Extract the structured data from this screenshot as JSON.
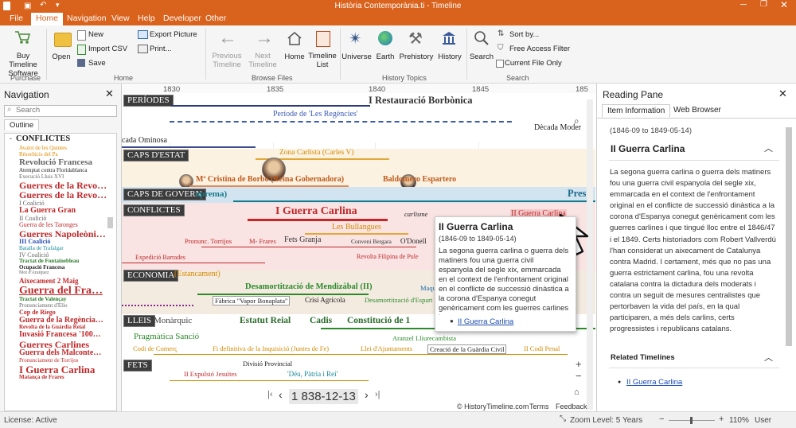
{
  "window": {
    "title": "Història Contemporània.ti - Timeline"
  },
  "menu": {
    "file": "File",
    "home": "Home",
    "navigation": "Navigation",
    "view": "View",
    "help": "Help",
    "developer": "Developer",
    "other": "Other"
  },
  "ribbon": {
    "buy": "Buy Timeline Software",
    "purchase_group": "Purchase",
    "open": "Open",
    "new": "New",
    "import_csv": "Import CSV",
    "save": "Save",
    "export_picture": "Export Picture",
    "print": "Print...",
    "home_group": "Home",
    "prev_timeline": "Previous Timeline",
    "next_timeline": "Next Timeline",
    "home_btn": "Home",
    "timeline_list": "Timeline List",
    "browse_group": "Browse Files",
    "universe": "Universe",
    "earth": "Earth",
    "prehistory": "Prehistory",
    "history": "History",
    "history_group": "History Topics",
    "search": "Search",
    "sort_by": "Sort by...",
    "free_access_filter": "Free Access Filter",
    "current_file_only": "Current File Only",
    "search_group": "Search"
  },
  "navigation": {
    "title": "Navigation",
    "search_placeholder": "Search",
    "outline_tab": "Outline",
    "root": "CONFLICTES",
    "items": [
      {
        "label": "Avalot de les Quintes",
        "color": "#e08a00",
        "size": 7
      },
      {
        "label": "Rèsorbicis del Pa",
        "color": "#e08a00",
        "size": 7
      },
      {
        "label": "Revolució Francesa",
        "color": "#666666",
        "size": 11,
        "bold": true
      },
      {
        "label": "Atemptat contra Floridablanca",
        "color": "#222222",
        "size": 7
      },
      {
        "label": "Execució Lluis XVI",
        "color": "#666666",
        "size": 7
      },
      {
        "label": "Guerres de la Revo…",
        "color": "#c0282a",
        "size": 12,
        "bold": true
      },
      {
        "label": "Guerres de la Revo…",
        "color": "#c0282a",
        "size": 12,
        "bold": true
      },
      {
        "label": "I Coalició",
        "color": "#666666",
        "size": 8
      },
      {
        "label": "La Guerra Gran",
        "color": "#c0282a",
        "size": 10,
        "bold": true
      },
      {
        "label": "II Coalició",
        "color": "#666666",
        "size": 8
      },
      {
        "label": "Guerra de les Taronges",
        "color": "#c0282a",
        "size": 8
      },
      {
        "label": "Guerres Napoleòni…",
        "color": "#c0282a",
        "size": 12,
        "bold": true
      },
      {
        "label": "III Coalició",
        "color": "#2a4cb0",
        "size": 8,
        "bold": true
      },
      {
        "label": "Batalla de Trafalgar",
        "color": "#1a8a9a",
        "size": 7
      },
      {
        "label": "IV Coalició",
        "color": "#666666",
        "size": 8
      },
      {
        "label": "Tractat de Fontainebleau",
        "color": "#2a7a2a",
        "size": 7,
        "bold": true
      },
      {
        "label": "Ocupació Francesa",
        "color": "#222222",
        "size": 7,
        "bold": true
      },
      {
        "label": "Mot d'Aranjuez",
        "color": "#666666",
        "size": 6
      },
      {
        "label": "Aixecament 2 Maig",
        "color": "#c0282a",
        "size": 9,
        "bold": true
      },
      {
        "label": "Guerra del Fra…",
        "color": "#c0282a",
        "size": 14,
        "bold": true,
        "underline": true
      },
      {
        "label": "Tractat de Valençay",
        "color": "#2a7a2a",
        "size": 7,
        "bold": true
      },
      {
        "label": "Pronunciament d'Elio",
        "color": "#666666",
        "size": 7
      },
      {
        "label": "Cop de Riego",
        "color": "#c0282a",
        "size": 8,
        "bold": true
      },
      {
        "label": "Guerra de la Regència…",
        "color": "#c0282a",
        "size": 10,
        "bold": true
      },
      {
        "label": "Revolta de la Guàrdia Reial",
        "color": "#c0282a",
        "size": 7,
        "bold": true
      },
      {
        "label": "Invasió Francesa '100…",
        "color": "#c0282a",
        "size": 10,
        "bold": true
      },
      {
        "label": "Guerres Carlines",
        "color": "#c0282a",
        "size": 12,
        "bold": true
      },
      {
        "label": "Guerra dels Malconte…",
        "color": "#c0282a",
        "size": 10,
        "bold": true
      },
      {
        "label": "Pronunciament de Torrijos",
        "color": "#c0282a",
        "size": 7
      },
      {
        "label": "I Guerra Carlina",
        "color": "#c0282a",
        "size": 13,
        "bold": true
      },
      {
        "label": "Matança de Frares",
        "color": "#c0282a",
        "size": 7,
        "bold": true
      }
    ]
  },
  "timeline": {
    "years": [
      "1830",
      "1835",
      "1840",
      "1845",
      "185"
    ],
    "bands": {
      "periodes": "PERÍODES",
      "caps_estat": "CAPS D'ESTAT",
      "caps_govern": "CAPS DE GOVERN",
      "conflictes": "CONFLICTES",
      "economia": "ECONOMIA",
      "lleis": "LLEIS",
      "fets": "FETS"
    },
    "events": {
      "restauracio": "I Restauració Borbònica",
      "regencies": "Període de 'Les Regències'",
      "decada_moderada": "Dècada Moder",
      "decada_ominosa": "cada Ominosa",
      "zona_carlista": "Zona Carlista (Carles V)",
      "maria_cristina": "Mª Cristina de Borbó (Reina Gobernadora)",
      "baldomero": "Baldomero Espartero",
      "suprema": "uprema)",
      "pres": "Pres",
      "guerra_carlina": "I Guerra Carlina",
      "carlisme": "carlisme",
      "ii_guerra_carlina": "II Guerra Carlina",
      "bullangues": "Les Bullangues",
      "pronunc_torrijos": "Pronunc. Torrijos",
      "m_frares": "M- Frares",
      "fets_granja": "Fets Granja",
      "conveni_bergara": "Conveni Bergara",
      "odonnell": "O'Donell",
      "exped_barrades": "Expedició Barrades",
      "revolta_filipina": "Revolta Filipina de Pule",
      "estancament": "(Estancament)",
      "desamortitzacio": "Desamortització de Mendizàbal (II)",
      "fabrica_vapor": "Fàbrica \"Vapor Bonaplata\"",
      "crisi_agricola": "Crisi Agrícola",
      "desamortitzacio_esp": "Desamortització d'Espart",
      "maq": "Maqu",
      "monarquic": "Monàrquic",
      "estatut_reial": "Estatut Reial",
      "cadis": "Cadis",
      "constitucio": "Constitució de 1",
      "pragmatica": "Pragmàtica Sanció",
      "aranzel": "Aranzel Lliurecambista",
      "codi_comerc": "Codi de Comerç",
      "fi_inquisicio": "Fi definitiva de la Inquisició (Juntes de Fe)",
      "llei_ajuntaments": "Llei d'Ajuntaments",
      "creacio_guardia": "Creació de la Guàrdia Civil",
      "ii_codi_penal": "II Codi Penal",
      "divisio_provincial": "Divisió Provincial",
      "ii_expulsio": "II Expulsió Jesuïtes",
      "deu_patria": "'Déu, Pàtria i Rei'"
    },
    "date": "1 838-12-13",
    "credits": {
      "site": "© HistoryTimeline.com",
      "terms": "Terms",
      "feedback": "Feedback"
    }
  },
  "popup": {
    "title": "II Guerra Carlina",
    "dates": "(1846-09 to 1849-05-14)",
    "body": "La segona guerra carlina o guerra dels matiners fou una guerra civil espanyola del segle xix, emmarcada en el context de l'enfrontament original en el conflicte de successió dinàstica a la corona d'Espanya conegut genèricament com les guerres carlines i",
    "link": "II Guerra Carlina"
  },
  "reading": {
    "title": "Reading Pane",
    "tab_info": "Item Information",
    "tab_web": "Web Browser",
    "dates": "(1846-09 to 1849-05-14)",
    "heading": "II Guerra Carlina",
    "body": "La segona guerra carlina o guerra dels matiners fou una guerra civil espanyola del segle xix, emmarcada en el context de l'enfrontament original en el conflicte de successió dinàstica a la corona d'Espanya conegut genèricament com les guerres carlines i que tingué lloc entre el 1846/47 i el 1849. Certs historiadors com Robert Vallverdú l'han considerat un aixecament de Catalunya contra Madrid. I certament, més que no pas una guerra estrictament carlina, fou una revolta catalana contra la dictadura dels moderats i contra un seguit de mesures centralistes que pertorbaven la vida del país, en la qual participaren, a més dels carlins, certs progressistes i republicans catalans.",
    "related_title": "Related Timelines",
    "related_link": "II Guerra Carlina"
  },
  "status": {
    "license": "License: Active",
    "zoom": "Zoom Level: 5 Years",
    "percent": "110%",
    "user": "User"
  }
}
